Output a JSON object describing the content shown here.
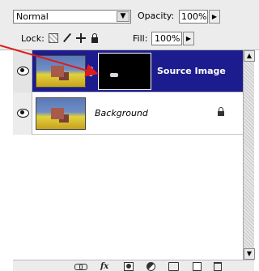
{
  "blend_mode": {
    "value": "Normal"
  },
  "opacity": {
    "label": "Opacity:",
    "value": "100%"
  },
  "lock": {
    "label": "Lock:"
  },
  "fill": {
    "label": "Fill:",
    "value": "100%"
  },
  "layers": [
    {
      "name": "Source Image",
      "selected": true,
      "visible": true,
      "has_mask": true
    },
    {
      "name": "Background",
      "selected": false,
      "visible": true,
      "locked": true
    }
  ],
  "colors": {
    "selection": "#1c1c8e",
    "annotation_arrow": "#e01b1b",
    "panel": "#ececec"
  },
  "icons": {
    "dropdown": "chevron-down-icon",
    "flyout": "chevron-right-icon",
    "eye": "eye-icon",
    "link": "link-icon",
    "lock": "lock-icon",
    "fx": "fx-icon",
    "trash": "trash-icon"
  },
  "toolbar": {
    "fx_label": "fx"
  }
}
